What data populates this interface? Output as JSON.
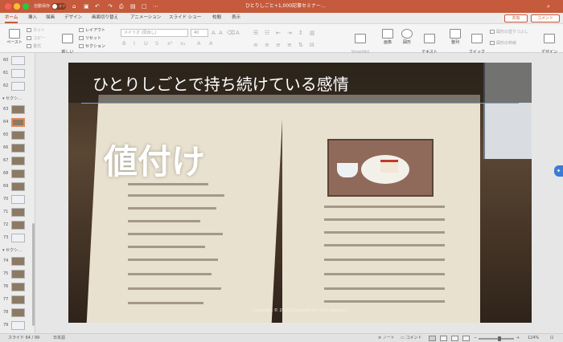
{
  "window": {
    "title": "ひとりしごと+1,000記事セミナー…",
    "autosave_label": "自動保存",
    "autosave_state": "オフ"
  },
  "ribbon_tabs": [
    "ホーム",
    "挿入",
    "描画",
    "デザイン",
    "画面切り替え",
    "アニメーション",
    "スライド ショー",
    "校閲",
    "表示"
  ],
  "share_button": "共有",
  "comments_button": "コメント",
  "ribbon": {
    "paste": "ペースト",
    "cut": "カット",
    "copy": "コピー",
    "format": "書式",
    "new_slide": "新しい\nスライド",
    "layout": "レイアウト",
    "reset": "リセット",
    "section": "セクション",
    "font_name": "メイリオ (見出し)",
    "font_size": "40",
    "smartart": "SmartArt\nに変換",
    "image": "画像",
    "shapes": "図形",
    "textbox": "テキスト\nボックス",
    "arrange": "整列",
    "quick_styles": "クイック\nスタイル",
    "shape_fill": "図形の塗りつぶし",
    "shape_outline": "図形の枠線",
    "design_ideas": "デザイン\nアイデア"
  },
  "thumbnails": {
    "sections": [
      "セクシ…",
      "セクシ…"
    ],
    "slides": [
      "60",
      "61",
      "62",
      "63",
      "64",
      "65",
      "66",
      "67",
      "68",
      "69",
      "70",
      "71",
      "72",
      "73",
      "74",
      "75",
      "76",
      "77",
      "78",
      "79"
    ],
    "selected": "64"
  },
  "slide": {
    "title": "ひとりしごとで持ち続けている感情",
    "heading": "値付け",
    "copyright": "Copyright © 2019 Consuloot All right reserved"
  },
  "statusbar": {
    "slide_info": "スライド 64 / 99",
    "language": "日本語",
    "notes": "ノート",
    "comments": "コメント",
    "zoom": "124%"
  },
  "colors": {
    "accent": "#c55a3c",
    "title_underline": "#6fa8dc"
  },
  "icons": [
    "autosave-toggle",
    "home-icon",
    "save-icon",
    "undo-icon",
    "redo-icon",
    "print-icon",
    "search-icon"
  ]
}
